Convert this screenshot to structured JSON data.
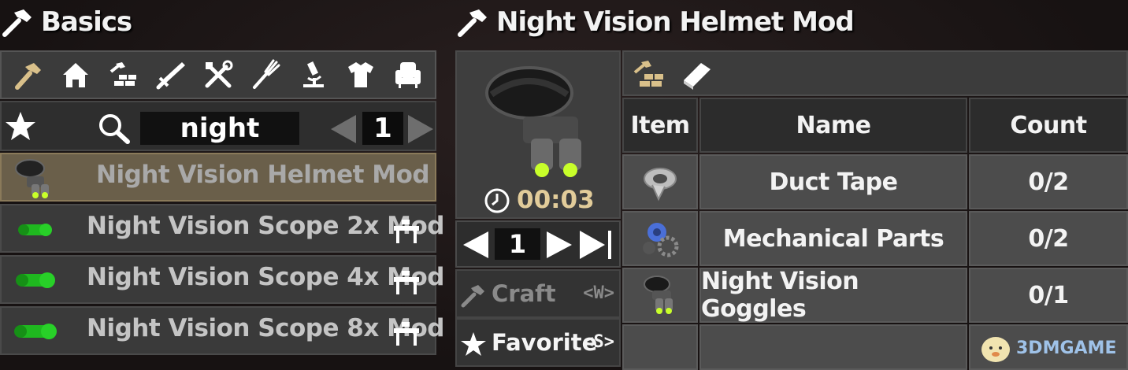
{
  "left_panel": {
    "title": "Basics",
    "categories": [
      {
        "icon": "hammer-icon",
        "active": true
      },
      {
        "icon": "house-icon"
      },
      {
        "icon": "building-icon"
      },
      {
        "icon": "weapon-icon"
      },
      {
        "icon": "tools-icon"
      },
      {
        "icon": "fork-icon"
      },
      {
        "icon": "microscope-icon"
      },
      {
        "icon": "shirt-icon"
      },
      {
        "icon": "chair-icon"
      }
    ],
    "search": {
      "value": "night"
    },
    "page": "1",
    "recipes": [
      {
        "name": "Night Vision Helmet Mod",
        "selected": true,
        "workbench": false
      },
      {
        "name": "Night Vision Scope 2x Mod",
        "workbench": true
      },
      {
        "name": "Night Vision Scope 4x Mod",
        "workbench": true
      },
      {
        "name": "Night Vision Scope 8x Mod",
        "workbench": true
      }
    ]
  },
  "right_panel": {
    "title": "Night Vision Helmet Mod",
    "craft_time": "00:03",
    "quantity": "1",
    "actions": {
      "craft": {
        "label": "Craft",
        "key": "<W>"
      },
      "favorite": {
        "label": "Favorite",
        "key": "<S>"
      }
    },
    "table": {
      "headers": {
        "item": "Item",
        "name": "Name",
        "count": "Count"
      },
      "rows": [
        {
          "icon": "duct-tape-icon",
          "name": "Duct Tape",
          "count": "0/2"
        },
        {
          "icon": "mechanical-parts-icon",
          "name": "Mechanical Parts",
          "count": "0/2"
        },
        {
          "icon": "night-vision-goggles-icon",
          "name": "Night Vision Goggles",
          "count": "0/1"
        }
      ]
    }
  },
  "watermark": "3DMGAME",
  "colors": {
    "selected_row": "#6a5f4a",
    "timer_text": "#e2cc9a",
    "accent_tan": "#d9c08a",
    "green_scope": "#1fb81f"
  }
}
